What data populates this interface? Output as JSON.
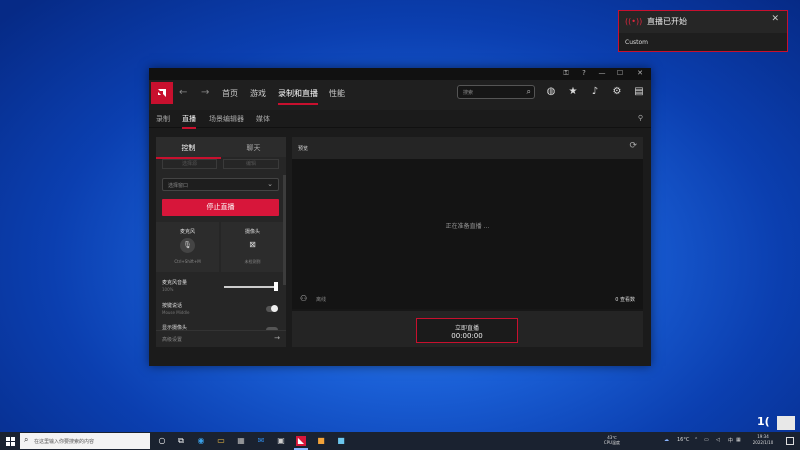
{
  "toast": {
    "title": "直播已开始",
    "subtitle": "Custom",
    "close": "✕"
  },
  "window": {
    "title_buttons": [
      "⚿",
      "?",
      "—",
      "☐",
      "✕"
    ],
    "nav": {
      "home": "首页",
      "games": "游戏",
      "record": "录制和直播",
      "performance": "性能"
    },
    "search_placeholder": "搜索",
    "subtabs": {
      "record": "录制",
      "live": "直播",
      "scene_editor": "场景编辑器",
      "media": "媒体"
    },
    "left": {
      "tab_control": "控制",
      "tab_chat": "聊天",
      "faded_btn1": "选择源",
      "faded_btn2": "编辑",
      "select_value": "选择窗口",
      "stop_button": "停止直播",
      "mic_label": "麦克风",
      "mic_shortcut": "Ctrl+Shift+M",
      "cam_label": "摄像头",
      "cam_status": "未检测到",
      "mic_volume_label": "麦克风音量",
      "mic_volume_value": "100%",
      "ptt_label": "按键说话",
      "ptt_key": "Mouse Middle",
      "cut_label": "显示摄像头",
      "footer": "高级设置",
      "mic_volume_level": 1.0
    },
    "right": {
      "header": "预览",
      "preparing": "正在准备直播 ...",
      "status": "离线",
      "viewers": "0 查看数",
      "live_label": "立即直播",
      "timer": "00:00:00"
    }
  },
  "taskbar": {
    "search_placeholder": "在这里输入你要搜索的内容",
    "weather_top": "43℃",
    "weather_bottom": "CPU温度",
    "temp": "16°C",
    "lang": "中",
    "clock_time": "19:34",
    "clock_date": "2022/1/10"
  },
  "colors": {
    "accent": "#c8102e",
    "stop_button": "#d7163a"
  }
}
